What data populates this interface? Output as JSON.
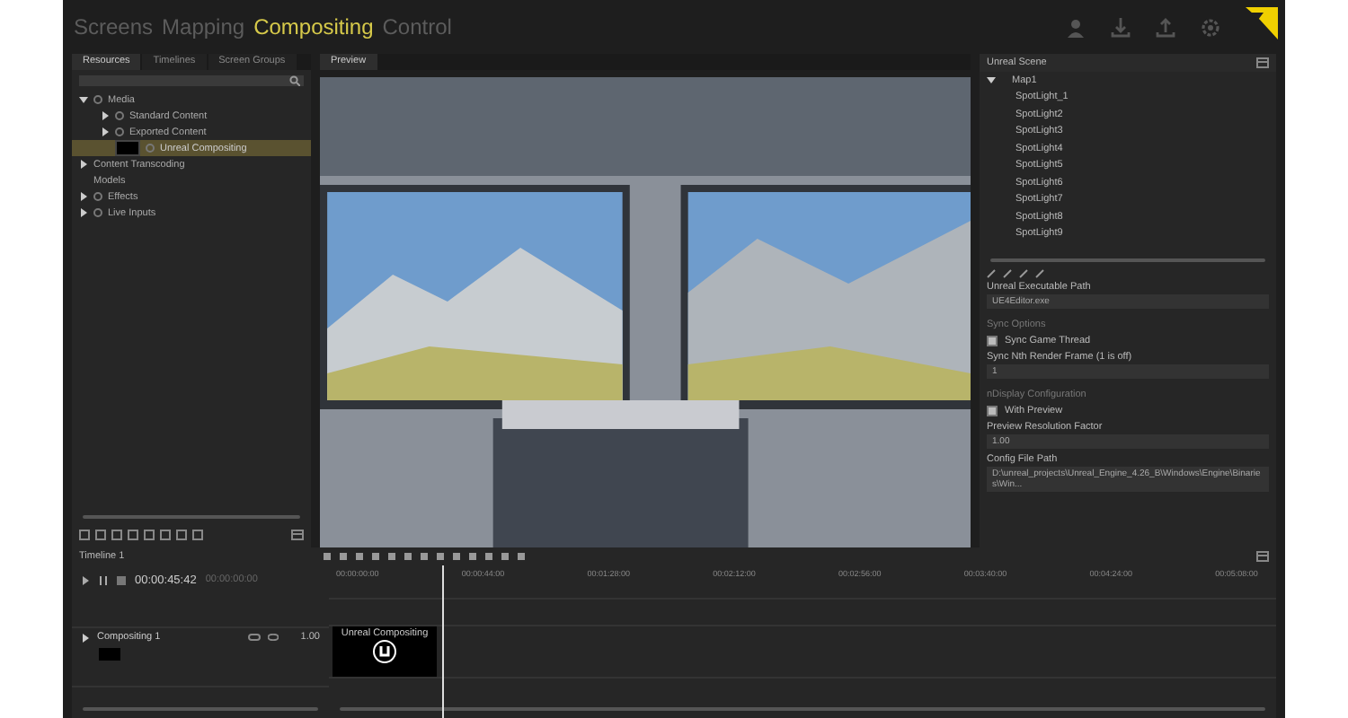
{
  "nav": {
    "tabs": [
      {
        "label": "Screens",
        "selected": false
      },
      {
        "label": "Mapping",
        "selected": false
      },
      {
        "label": "Compositing",
        "selected": true
      },
      {
        "label": "Control",
        "selected": false
      }
    ]
  },
  "resources": {
    "tabs": [
      {
        "label": "Resources",
        "selected": true
      },
      {
        "label": "Timelines",
        "selected": false
      },
      {
        "label": "Screen Groups",
        "selected": false
      }
    ],
    "tree": [
      {
        "label": "Media",
        "expanded": true,
        "checkbox": true,
        "selected": false,
        "children": [
          {
            "label": "Standard Content",
            "expanded": false,
            "checkbox": true,
            "selected": false
          },
          {
            "label": "Exported Content",
            "expanded": false,
            "checkbox": true,
            "selected": false
          },
          {
            "label": "Unreal Compositing",
            "checkbox": true,
            "thumbnail": true,
            "selected": true
          }
        ]
      },
      {
        "label": "Content Transcoding",
        "expanded": false,
        "selected": false
      },
      {
        "label": "Models",
        "selected": false
      },
      {
        "label": "Effects",
        "expanded": false,
        "checkbox": true,
        "selected": false
      },
      {
        "label": "Live Inputs",
        "expanded": false,
        "checkbox": true,
        "selected": false
      }
    ]
  },
  "preview": {
    "tabs": [
      {
        "label": "Preview",
        "selected": true
      }
    ]
  },
  "scene": {
    "title": "Unreal Scene",
    "tree": [
      {
        "label": "Map1",
        "expanded": true,
        "children": [
          {
            "label": "SpotLight_1"
          },
          {
            "label": "SpotLight2"
          },
          {
            "label": "SpotLight3"
          },
          {
            "label": "SpotLight4"
          },
          {
            "label": "SpotLight5"
          },
          {
            "label": "SpotLight6"
          },
          {
            "label": "SpotLight7"
          },
          {
            "label": "SpotLight8"
          },
          {
            "label": "SpotLight9"
          }
        ]
      }
    ],
    "fields": [
      {
        "kind": "input",
        "label": "Unreal Executable Path",
        "value": "UE4Editor.exe"
      },
      {
        "kind": "heading",
        "label": "Sync Options"
      },
      {
        "kind": "checkbox",
        "label": "Sync Game Thread",
        "checked": true
      },
      {
        "kind": "input",
        "label": "Sync Nth Render Frame (1 is off)",
        "value": "1"
      },
      {
        "kind": "heading",
        "label": "nDisplay Configuration"
      },
      {
        "kind": "checkbox",
        "label": "With Preview",
        "checked": true
      },
      {
        "kind": "input",
        "label": "Preview Resolution Factor",
        "value": "1.00"
      },
      {
        "kind": "input",
        "label": "Config File Path",
        "value": "D:\\unreal_projects\\Unreal_Engine_4.26_B\\Windows\\Engine\\Binaries\\Win..."
      }
    ]
  },
  "timeline": {
    "tab": "Timeline 1",
    "timecode": "00:00:45:42",
    "timecode_end": "00:00:00:00",
    "ruler": [
      "00:00:00:00",
      "00:00:44:00",
      "00:01:28:00",
      "00:02:12:00",
      "00:02:56:00",
      "00:03:40:00",
      "00:04:24:00",
      "00:05:08:00"
    ],
    "tracks": [
      {
        "name": "Compositing 1",
        "opacity": "1.00",
        "clip": "Unreal Compositing"
      }
    ]
  }
}
